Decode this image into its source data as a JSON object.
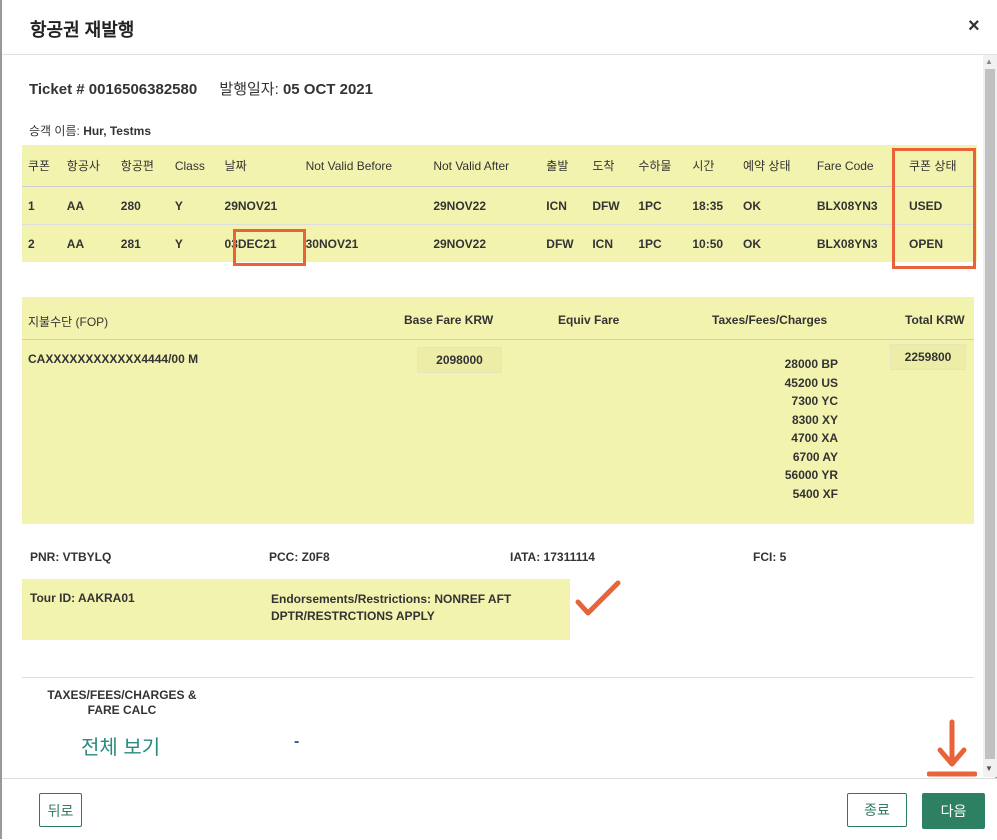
{
  "window": {
    "title": "항공권 재발행",
    "close_label": "×"
  },
  "ticket": {
    "number_label": "Ticket # 0016506382580",
    "issue_label": "발행일자:",
    "issue_date": "05 OCT 2021"
  },
  "passenger": {
    "label": "승객 이름:",
    "name": "Hur, Testms"
  },
  "coupons": {
    "headers": [
      "쿠폰",
      "항공사",
      "항공편",
      "Class",
      "날짜",
      "Not Valid Before",
      "Not Valid After",
      "출발",
      "도착",
      "수하물",
      "시간",
      "예약 상태",
      "Fare Code",
      "쿠폰 상태"
    ],
    "rows": [
      [
        "1",
        "AA",
        "280",
        "Y",
        "29NOV21",
        "",
        "29NOV22",
        "ICN",
        "DFW",
        "1PC",
        "18:35",
        "OK",
        "BLX08YN3",
        "USED"
      ],
      [
        "2",
        "AA",
        "281",
        "Y",
        "03DEC21",
        "30NOV21",
        "29NOV22",
        "DFW",
        "ICN",
        "1PC",
        "10:50",
        "OK",
        "BLX08YN3",
        "OPEN"
      ]
    ]
  },
  "fare": {
    "headers": {
      "fop": "지불수단 (FOP)",
      "base": "Base Fare KRW",
      "equiv": "Equiv Fare",
      "taxes": "Taxes/Fees/Charges",
      "total": "Total KRW"
    },
    "fop_value": "CAXXXXXXXXXXXX4444/00 M",
    "base_value": "2098000",
    "taxes": [
      "28000 BP",
      "45200 US",
      "7300 YC",
      "8300 XY",
      "4700 XA",
      "6700 AY",
      "56000 YR",
      "5400 XF"
    ],
    "total_value": "2259800"
  },
  "info": {
    "pnr": "PNR: VTBYLQ",
    "pcc": "PCC: Z0F8",
    "iata": "IATA: 17311114",
    "fci": "FCI: 5"
  },
  "endorsement": {
    "tour": "Tour ID: AAKRA01",
    "text": "Endorsements/Restrictions: NONREF AFT DPTR/RESTRCTIONS APPLY"
  },
  "fare_calc": {
    "label": "TAXES/FEES/CHARGES & FARE CALC",
    "view_all": "전체 보기",
    "value": "-"
  },
  "footer": {
    "back_label": "뒤로",
    "end_label": "종료",
    "next_label": "다음"
  },
  "colors": {
    "highlight": "#f3f3b0",
    "annotation": "#e8633a",
    "primary": "#2e8062"
  }
}
